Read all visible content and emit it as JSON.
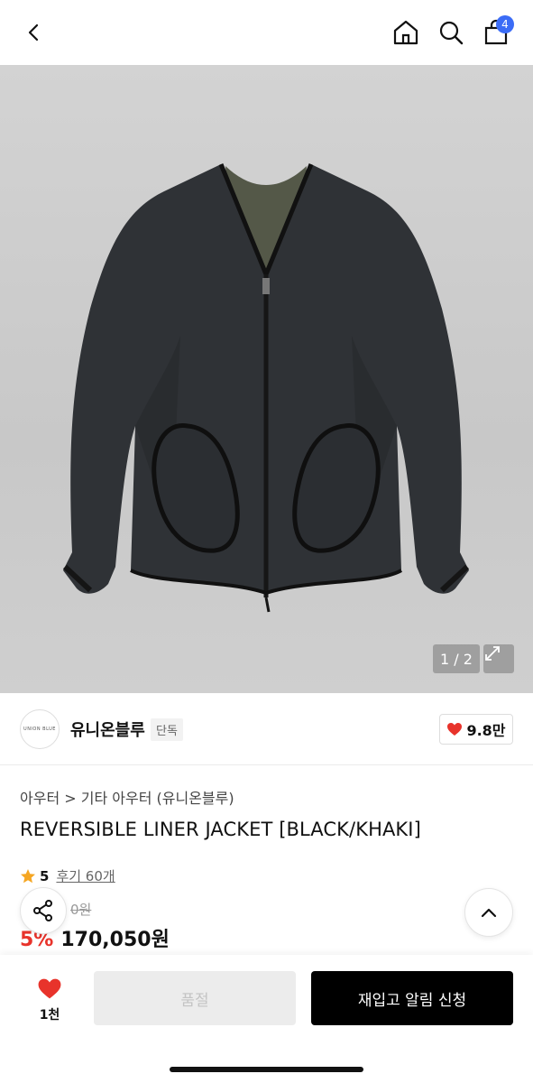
{
  "header": {
    "cart_count": "4"
  },
  "gallery": {
    "pager": "1 / 2"
  },
  "brand": {
    "logo_text": "UNION BLUE",
    "name": "유니온블루",
    "tag": "단독",
    "likes": "9.8만"
  },
  "product": {
    "breadcrumb": "아우터 > 기타 아우터 (유니온블루)",
    "title": "REVERSIBLE LINER JACKET [BLACK/KHAKI]",
    "rating": "5",
    "reviews": "후기 60개",
    "original_price": "0원",
    "discount": "5%",
    "price": "170,050원"
  },
  "bottom_bar": {
    "wish_count": "1천",
    "soldout_label": "품절",
    "notify_label": "재입고 알림 신청"
  },
  "colors": {
    "accent_blue": "#3b6cf6",
    "discount_red": "#e8332b",
    "heart_red": "#e8332b",
    "star": "#f5a623"
  }
}
